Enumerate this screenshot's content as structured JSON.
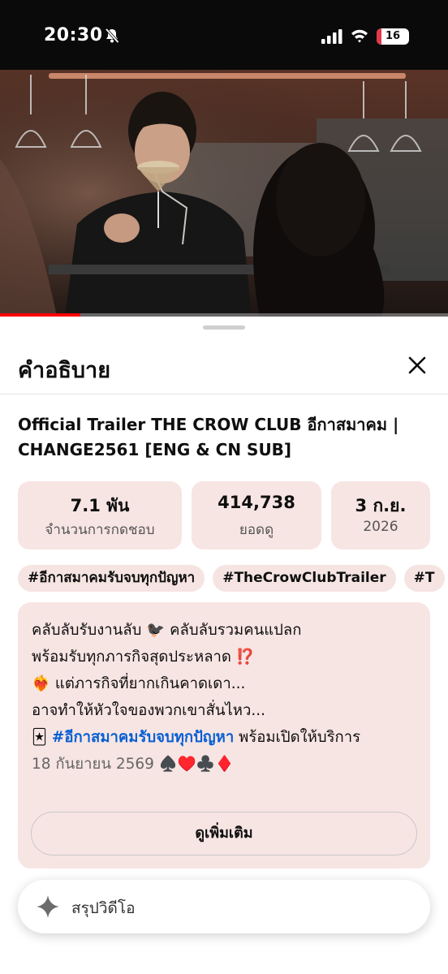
{
  "status_bar": {
    "time": "20:30",
    "battery_level": "16",
    "battery_fraction": 0.16
  },
  "video": {
    "progress_fraction": 0.18
  },
  "description_panel": {
    "heading": "คำอธิบาย",
    "video_title": "Official Trailer THE CROW CLUB อีกาสมาคม | CHANGE2561 [ENG & CN SUB]",
    "stats": [
      {
        "value": "7.1 พัน",
        "label": "จำนวนการกดชอบ"
      },
      {
        "value": "414,738",
        "label": "ยอดดู"
      },
      {
        "value": "3 ก.ย.",
        "label": "2026"
      }
    ],
    "hashtags": [
      "#อีกาสมาคมรับจบทุกปัญหา",
      "#TheCrowClubTrailer",
      "#T"
    ],
    "description": {
      "line1": "คลับลับรับงานลับ 🐦‍⬛ คลับลับรวมคนแปลก",
      "line2": "พร้อมรับทุกภารกิจสุดประหลาด ⁉️",
      "line3": "❤️‍🔥 แต่ภารกิจที่ยากเกินคาดเดา...",
      "line4": "อาจทำให้หัวใจของพวกเขาสั่นไหว...",
      "line5_prefix": "🃏",
      "line5_link": "#อีกาสมาคมรับจบทุกปัญหา",
      "line5_suffix": "พร้อมเปิดให้บริการ",
      "line6_date": "18 กันยายน 2569",
      "line6_suits": "♠️♥️♣️♦️"
    },
    "show_more_label": "ดูเพิ่มเติม",
    "summary_label": "สรุปวิดีโอ"
  },
  "colors": {
    "link": "#065fd4",
    "card_bg": "#f7e5e3",
    "progress": "#ff0000"
  }
}
